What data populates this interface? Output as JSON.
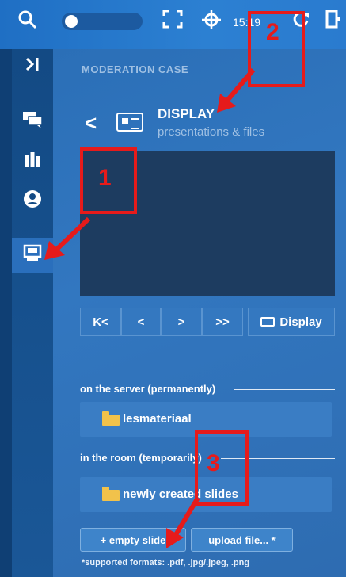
{
  "status_bar": {
    "time": "15:19",
    "icons": [
      "search-icon",
      "fullscreen-icon",
      "crosshair-icon",
      "refresh-icon",
      "exit-icon"
    ]
  },
  "sidebar": {
    "items": [
      {
        "name": "collapse",
        "icon": "collapse-icon"
      },
      {
        "name": "chat",
        "icon": "chat-icon"
      },
      {
        "name": "tools",
        "icon": "tools-icon"
      },
      {
        "name": "user",
        "icon": "user-icon"
      },
      {
        "name": "display",
        "icon": "display-icon",
        "active": true
      }
    ]
  },
  "main": {
    "case_title": "MODERATION CASE",
    "back_label": "<",
    "heading": "DISPLAY",
    "subheading": "presentations & files",
    "controls": {
      "first": "K<",
      "prev": "<",
      "next": ">",
      "last": ">>",
      "display": "Display"
    },
    "server_section": "on the server (permanently)",
    "server_folder": "lesmateriaal",
    "room_section": "in the room (temporarily)",
    "room_folder": "newly created slides",
    "empty_slide_button": "+ empty slide",
    "upload_button": "upload file... *",
    "formats_note": "*supported formats: .pdf, .jpg/.jpeg, .png"
  },
  "annotations": {
    "labels": [
      "1",
      "2",
      "3"
    ],
    "color": "#e61b1b"
  }
}
